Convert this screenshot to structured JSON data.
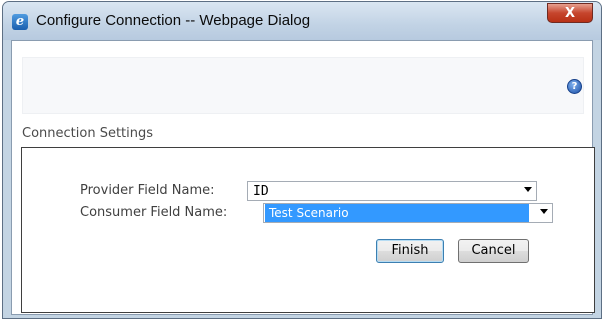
{
  "window": {
    "title": "Configure Connection -- Webpage Dialog",
    "app_icon": "internet-explorer-icon",
    "close_glyph": "X"
  },
  "toolbar": {
    "help_icon": "help-icon",
    "help_glyph": "?"
  },
  "section": {
    "title": "Connection Settings"
  },
  "form": {
    "provider_label": "Provider Field Name:",
    "provider_value": "ID",
    "consumer_label": "Consumer Field Name:",
    "consumer_value": "Test Scenario"
  },
  "buttons": {
    "finish": "Finish",
    "cancel": "Cancel"
  },
  "colors": {
    "title_bar": "#c2d3e5",
    "close_button": "#c6452d",
    "selection": "#3399ff",
    "help_icon": "#1b4fa6"
  }
}
